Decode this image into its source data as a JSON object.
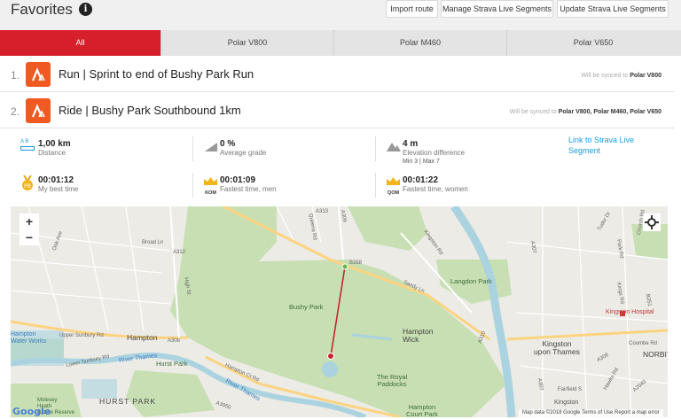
{
  "header": {
    "title": "Favorites",
    "buttons": {
      "import": "Import route",
      "manage": "Manage Strava Live Segments",
      "update": "Update Strava Live Segments"
    }
  },
  "tabs": [
    "All",
    "Polar V800",
    "Polar M460",
    "Polar V650"
  ],
  "segments": [
    {
      "num": "1.",
      "name": "Run | Sprint to end of Bushy Park Run",
      "sync_prefix": "Will be synced to",
      "sync_devices": "Polar V800"
    },
    {
      "num": "2.",
      "name": "Ride | Bushy Park Southbound 1km",
      "sync_prefix": "Will be synced to",
      "sync_devices": "Polar V800, Polar M460, Polar V650"
    }
  ],
  "stats": {
    "distance": {
      "value": "1,00 km",
      "label": "Distance",
      "icon_text": "A  B"
    },
    "grade": {
      "value": "0 %",
      "label": "Average grade"
    },
    "elevation": {
      "value": "4 m",
      "label": "Elevation difference",
      "sub": "Min 3 | Max 7"
    },
    "best": {
      "value": "00:01:12",
      "label": "My best time"
    },
    "kom": {
      "value": "00:01:09",
      "label": "Fastest time, men",
      "badge": "KOM"
    },
    "qom": {
      "value": "00:01:22",
      "label": "Fastest time, women",
      "badge": "QOM"
    },
    "link": "Link to Strava Live Segment"
  },
  "map": {
    "zoom_in": "+",
    "zoom_out": "−",
    "labels": {
      "bushy_park": "Bushy Park",
      "hampton_wick": "Hampton\nWick",
      "hampton": "Hampton",
      "hurst_park": "Hurst Park",
      "hurst_park_area": "HURST PARK",
      "langdon_park": "Langdon Park",
      "kingston": "Kingston\nupon Thames",
      "kingston_hospital": "Kingston Hospital",
      "royal_paddocks": "The Royal\nPaddocks",
      "hampton_court_park": "Hampton\nCourt Park",
      "molesey": "Molesey\nHeath\nNature Reserve",
      "river_thames": "River Thames",
      "river_thames2": "River Thames",
      "norbiton": "NORBIT",
      "hampton_works": "Hampton\nWater Works",
      "kingston2": "Kingston"
    },
    "roads": {
      "upper_sunbury": "Upper Sunbury Rd",
      "lower_sunbury": "Lower Sunbury Rd",
      "broad_ln": "Broad Ln",
      "oak_ave": "Oak Ave",
      "high_st": "High St",
      "a312": "A312",
      "a308": "A308",
      "a313": "A313",
      "a309": "A309",
      "a310": "A310",
      "b358": "B358",
      "sandy_ln": "Sandy Ln",
      "kingston_rd": "Kingston Rd",
      "hampton_ct_rd": "Hampton Ct Rd",
      "a3050": "A3050",
      "coombe_rd": "Coombe Rd",
      "a307": "A307",
      "a307b": "A307",
      "tudor_dr": "Tudor Dr",
      "a308b": "A308",
      "b351": "B351",
      "queens_rd": "Queens Rd",
      "park_rd": "Park Rd",
      "church_rd": "Church Rd",
      "kings_rd": "Kings Rd",
      "a2043": "A2043",
      "fairfield": "Fairfield S",
      "hawks_rd": "Hawks Rd"
    },
    "footer": "Map data ©2018 Google   Terms of Use   Report a map error",
    "google": "Google"
  },
  "colors": {
    "accent": "#d61f2a",
    "strava": "#f05a22",
    "link": "#1a9be0",
    "park": "#c8dfb3",
    "water": "#aad3df",
    "route": "#c2272d"
  }
}
